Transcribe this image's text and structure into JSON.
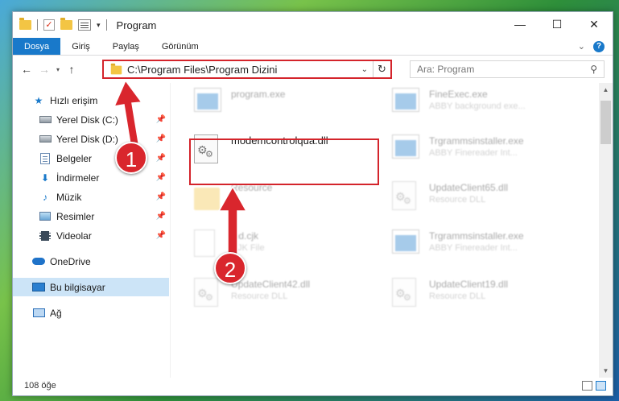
{
  "window": {
    "title": "Program",
    "controls": {
      "minimize": "—",
      "maximize": "☐",
      "close": "✕"
    }
  },
  "ribbon": {
    "tabs": [
      "Dosya",
      "Giriş",
      "Paylaş",
      "Görünüm"
    ],
    "active_tab": "Dosya",
    "expand": "⌄",
    "help": "?"
  },
  "navigation": {
    "back": "←",
    "forward": "→",
    "recent": "▾",
    "up": "↑",
    "address": "C:\\Program Files\\Program Dizini",
    "address_dropdown": "⌄",
    "refresh": "↻",
    "search_placeholder": "Ara: Program",
    "search_icon": "⚲"
  },
  "sidebar": {
    "items": [
      {
        "label": "Hızlı erişim",
        "icon": "star-icon",
        "pinned": false,
        "selected": false
      },
      {
        "label": "Yerel Disk (C:)",
        "icon": "drive-icon",
        "pinned": true,
        "selected": false
      },
      {
        "label": "Yerel Disk (D:)",
        "icon": "drive-icon",
        "pinned": true,
        "selected": false
      },
      {
        "label": "Belgeler",
        "icon": "documents-icon",
        "pinned": true,
        "selected": false
      },
      {
        "label": "İndirmeler",
        "icon": "download-icon",
        "pinned": true,
        "selected": false
      },
      {
        "label": "Müzik",
        "icon": "music-icon",
        "pinned": true,
        "selected": false
      },
      {
        "label": "Resimler",
        "icon": "pictures-icon",
        "pinned": true,
        "selected": false
      },
      {
        "label": "Videolar",
        "icon": "videos-icon",
        "pinned": true,
        "selected": false
      },
      {
        "label": "OneDrive",
        "icon": "onedrive-icon",
        "pinned": false,
        "selected": false
      },
      {
        "label": "Bu bilgisayar",
        "icon": "this-pc-icon",
        "pinned": false,
        "selected": true
      },
      {
        "label": "Ağ",
        "icon": "network-icon",
        "pinned": false,
        "selected": false
      }
    ],
    "pin_glyph": "📌"
  },
  "files": [
    {
      "name": "program.exe",
      "desc": "",
      "icon": "exe-icon",
      "faded": true
    },
    {
      "name": "FineExec.exe",
      "desc": "ABBY background exe...",
      "icon": "exe-icon",
      "faded": true
    },
    {
      "name": "modemcontrolqua.dll",
      "desc": "",
      "icon": "dll-icon",
      "faded": false
    },
    {
      "name": "Trgrammsinstaller.exe",
      "desc": "ABBY Finereader Int...",
      "icon": "exe-icon",
      "faded": true
    },
    {
      "name": "Resource",
      "desc": "",
      "icon": "folder-icon",
      "faded": true
    },
    {
      "name": "UpdateClient65.dll",
      "desc": "Resource DLL",
      "icon": "dll-icon",
      "faded": true
    },
    {
      "name": "ind.cjk",
      "desc": "CJK File",
      "icon": "cjk-file-icon",
      "faded": true
    },
    {
      "name": "Trgrammsinstaller.exe",
      "desc": "ABBY Finereader Int...",
      "icon": "exe-icon",
      "faded": true
    },
    {
      "name": "UpdateClient42.dll",
      "desc": "Resource DLL",
      "icon": "dll-icon",
      "faded": true
    },
    {
      "name": "UpdateClient19.dll",
      "desc": "Resource DLL",
      "icon": "dll-icon",
      "faded": true
    }
  ],
  "status": {
    "count": "108 öğe"
  },
  "annotations": {
    "step1": "1",
    "step2": "2",
    "highlight_color": "#d4242b"
  },
  "colors": {
    "accent": "#1979ca",
    "selected": "#cce4f7",
    "annotation": "#d4242b"
  }
}
